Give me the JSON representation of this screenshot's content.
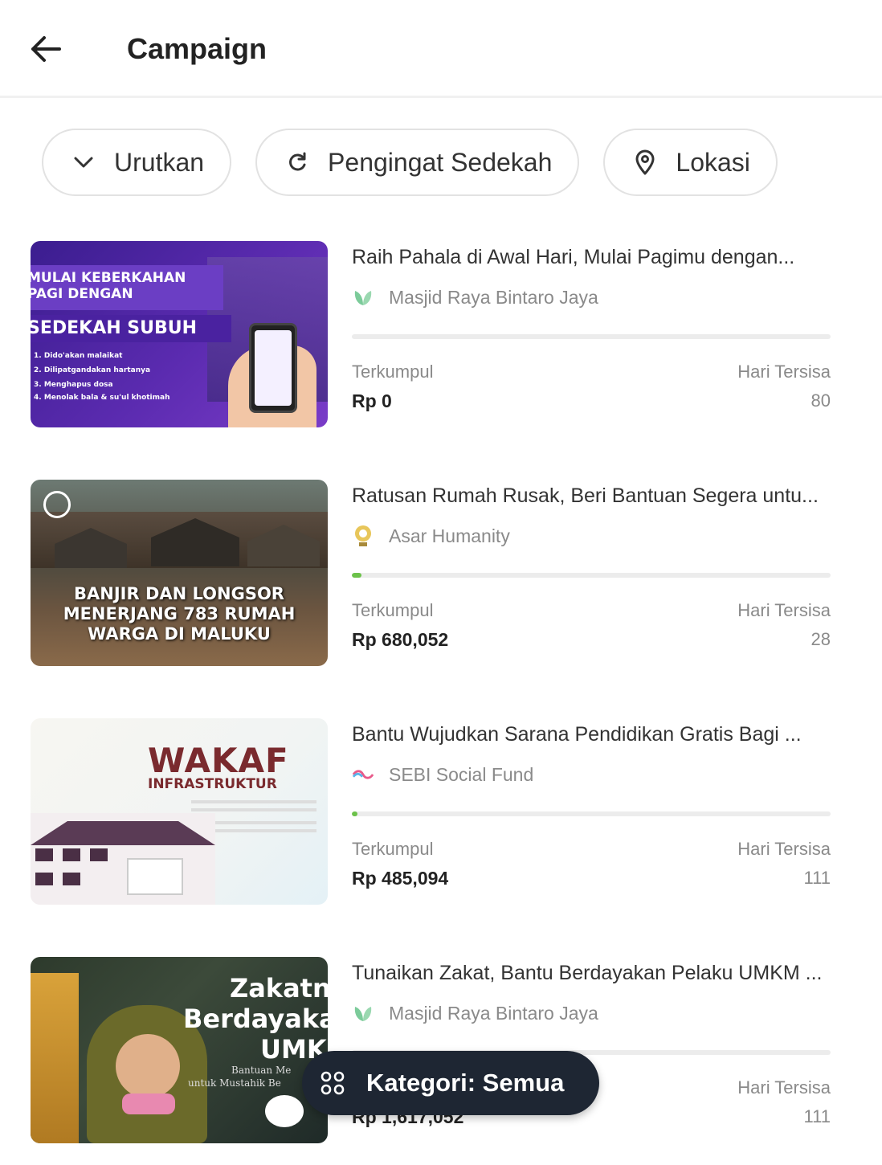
{
  "header": {
    "title": "Campaign"
  },
  "filters": [
    {
      "label": "Urutkan",
      "icon": "chevron-down-icon"
    },
    {
      "label": "Pengingat Sedekah",
      "icon": "refresh-icon"
    },
    {
      "label": "Lokasi",
      "icon": "location-pin-icon"
    }
  ],
  "labels": {
    "collected": "Terkumpul",
    "days_left": "Hari Tersisa"
  },
  "campaigns": [
    {
      "title": "Raih Pahala di Awal Hari, Mulai Pagimu dengan...",
      "org": "Masjid Raya Bintaro Jaya",
      "collected": "Rp 0",
      "days_left": "80",
      "progress": 0,
      "thumb": {
        "line1": "MULAI KEBERKAHAN",
        "line2": "PAGI DENGAN",
        "line3": "SEDEKAH SUBUH",
        "list": [
          "1. Dido'akan malaikat",
          "2. Dilipatgandakan hartanya",
          "3. Menghapus dosa",
          "4. Menolak bala & su'ul khotimah"
        ]
      }
    },
    {
      "title": "Ratusan Rumah Rusak, Beri Bantuan Segera untu...",
      "org": "Asar Humanity",
      "collected": "Rp 680,052",
      "days_left": "28",
      "progress": 0.02,
      "thumb": {
        "line1": "BANJIR DAN LONGSOR",
        "line2": "MENERJANG 783 RUMAH",
        "line3": "WARGA DI MALUKU"
      }
    },
    {
      "title": "Bantu Wujudkan Sarana Pendidikan Gratis Bagi ...",
      "org": "SEBI Social Fund",
      "collected": "Rp 485,094",
      "days_left": "111",
      "progress": 0.012,
      "thumb": {
        "line1": "WAKAF",
        "line2": "INFRASTRUKTUR"
      }
    },
    {
      "title": "Tunaikan Zakat, Bantu Berdayakan Pelaku UMKM ...",
      "org": "Masjid Raya Bintaro Jaya",
      "collected": "Rp 1,617,052",
      "days_left": "111",
      "progress": 0,
      "thumb": {
        "line1": "Zakatn",
        "line2": "Berdayaka",
        "line3": "UMK",
        "sub1": "Bantuan Me",
        "sub2": "untuk Mustahik Be"
      }
    }
  ],
  "fab": {
    "label": "Kategori: Semua",
    "icon": "grid-icon"
  },
  "colors": {
    "accent": "#6cc24a",
    "fab_bg": "#1e2633",
    "banner_purple": "#5b2bb0"
  }
}
